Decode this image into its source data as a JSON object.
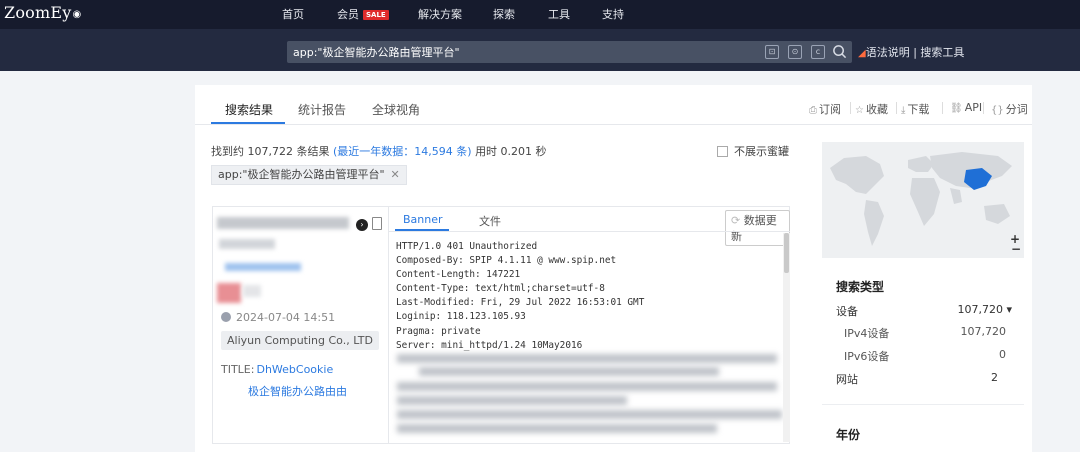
{
  "nav": {
    "logo": "ZoomEy",
    "items": [
      "首页",
      "会员",
      "解决方案",
      "探索",
      "工具",
      "支持"
    ],
    "sale_badge": "SALE"
  },
  "search": {
    "query": "app:\"极企智能办公路由管理平台\"",
    "syntax_help": "语法说明",
    "search_tools": "搜索工具",
    "separator": "|"
  },
  "tabs": [
    "搜索结果",
    "统计报告",
    "全球视角"
  ],
  "tools": [
    "订阅",
    "收藏",
    "下载",
    "API",
    "分词"
  ],
  "results_summary": {
    "prefix": "找到约 107,722 条结果",
    "recent": "(最近一年数据：14,594 条)",
    "time": "用时 0.201 秒"
  },
  "hide_honeypot": "不展示蜜罐",
  "filter_chip": "app:\"极企智能办公路由管理平台\"",
  "result": {
    "date": "2024-07-04 14:51",
    "org": "Aliyun Computing Co., LTD",
    "title_label": "TITLE:",
    "title_value": "DhWebCookie",
    "title_value2": "极企智能办公路由由",
    "banner_tabs": [
      "Banner",
      "文件"
    ],
    "refresh_label": "数据更新",
    "banner_lines": [
      "HTTP/1.0 401 Unauthorized",
      "Composed-By: SPIP 4.1.11 @ www.spip.net",
      "Content-Length: 147221",
      "Content-Type: text/html;charset=utf-8",
      "Last-Modified: Fri, 29 Jul 2022 16:53:01 GMT",
      "Loginip: 118.123.105.93",
      "Pragma: private",
      "Server: mini_httpd/1.24 10May2016"
    ]
  },
  "facets": {
    "search_type_title": "搜索类型",
    "rows": [
      {
        "label": "设备",
        "count": "107,720 ▾"
      },
      {
        "label": "IPv4设备",
        "count": "107,720"
      },
      {
        "label": "IPv6设备",
        "count": "0"
      },
      {
        "label": "网站",
        "count": "2"
      }
    ],
    "year_title": "年份"
  },
  "map": {
    "zoom_in": "+",
    "zoom_out": "−",
    "highlight_color": "#1f6fd6"
  }
}
